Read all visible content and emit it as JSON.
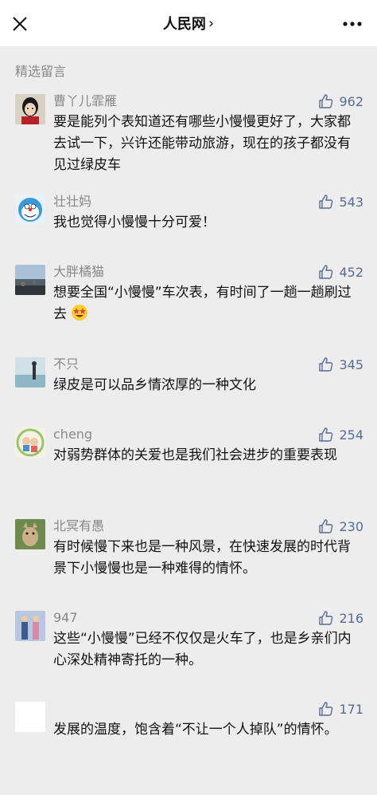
{
  "header": {
    "title": "人民网",
    "title_arrow": "›"
  },
  "section": {
    "label": "精选留言"
  },
  "comments": [
    {
      "name": "曹丫儿霏雁",
      "likes": "962",
      "text": "要是能列个表知道还有哪些小慢慢更好了，大家都去试一下，兴许还能带动旅游，现在的孩子都没有见过绿皮车"
    },
    {
      "name": "壮壮妈",
      "likes": "543",
      "text": "我也觉得小慢慢十分可爱！"
    },
    {
      "name": "大胖橘猫",
      "likes": "452",
      "text": "想要全国“小慢慢”车次表，有时间了一趟一趟刷过去"
    },
    {
      "name": "不只",
      "likes": "345",
      "text": "绿皮是可以品乡情浓厚的一种文化"
    },
    {
      "name": "cheng",
      "likes": "254",
      "text": "对弱势群体的关爱也是我们社会进步的重要表现"
    },
    {
      "name": "北冥有愚",
      "likes": "230",
      "text": "有时候慢下来也是一种风景，在快速发展的时代背景下小慢慢也是一种难得的情怀。"
    },
    {
      "name": "947",
      "likes": "216",
      "text": "这些“小慢慢”已经不仅仅是火车了，也是乡亲们内心深处精神寄托的一种。"
    },
    {
      "name": "",
      "likes": "171",
      "text": "发展的温度，饱含着“不让一个人掉队”的情怀。"
    }
  ],
  "colors": {
    "accent": "#576b95",
    "background": "#ededed",
    "secondary_text": "#888888"
  },
  "icons": {
    "close": "close-icon",
    "more": "more-icon",
    "like": "thumbs-up-icon",
    "emoji": "star-struck-emoji"
  }
}
